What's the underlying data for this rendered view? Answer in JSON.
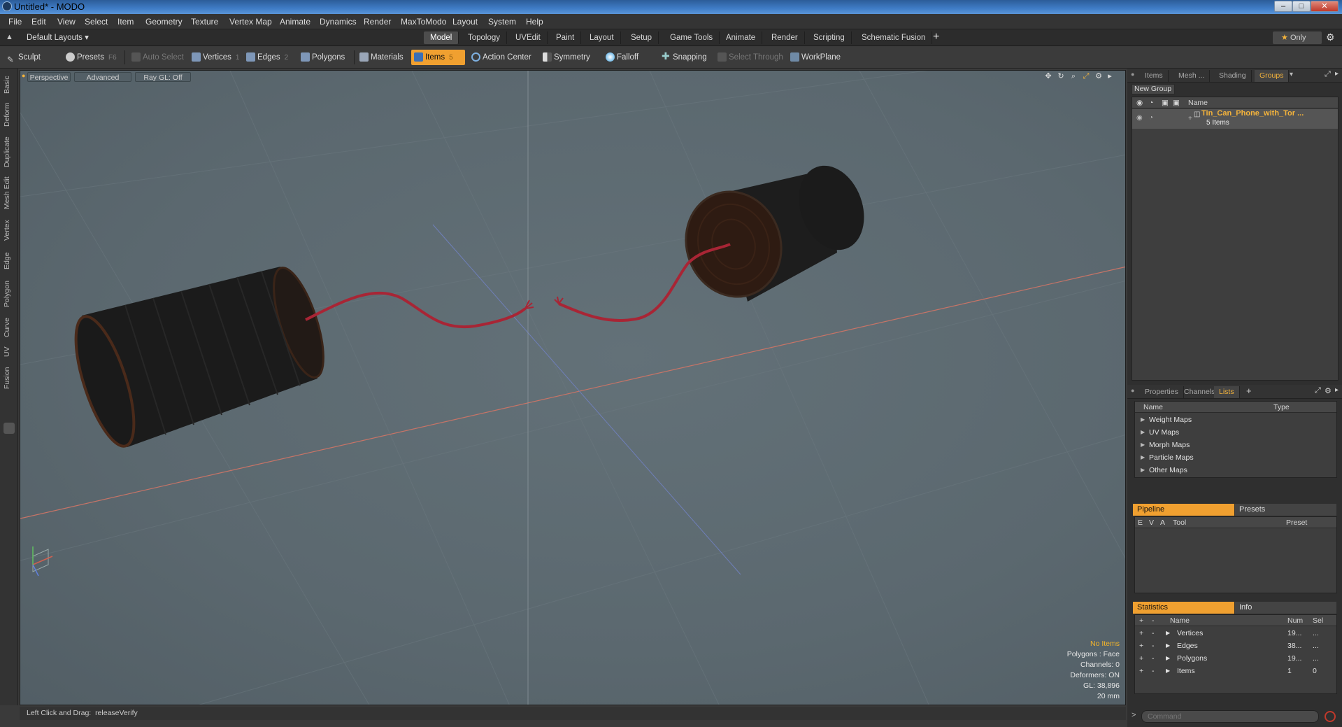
{
  "window": {
    "title": "Untitled* - MODO"
  },
  "menu": [
    "File",
    "Edit",
    "View",
    "Select",
    "Item",
    "Geometry",
    "Texture",
    "Vertex Map",
    "Animate",
    "Dynamics",
    "Render",
    "MaxToModo",
    "Layout",
    "System",
    "Help"
  ],
  "layout_selector": "Default Layouts",
  "layout_tabs": [
    "Model",
    "Topology",
    "UVEdit",
    "Paint",
    "Layout",
    "Setup",
    "Game Tools",
    "Animate",
    "Render",
    "Scripting",
    "Schematic Fusion"
  ],
  "active_layout_tab": "Model",
  "only_label": "Only",
  "toolbar": {
    "sculpt": "Sculpt",
    "presets": "Presets",
    "presets_hotkey": "F6",
    "auto_select": "Auto Select",
    "vertices": "Vertices",
    "vertices_hotkey": "1",
    "edges": "Edges",
    "edges_hotkey": "2",
    "polygons": "Polygons",
    "materials": "Materials",
    "items": "Items",
    "items_hotkey": "5",
    "action_center": "Action Center",
    "symmetry": "Symmetry",
    "falloff": "Falloff",
    "snapping": "Snapping",
    "select_through": "Select Through",
    "workplane": "WorkPlane"
  },
  "left_tabs": [
    "Basic",
    "Deform",
    "Duplicate",
    "Mesh Edit",
    "Vertex",
    "Edge",
    "Polygon",
    "Curve",
    "UV",
    "Fusion"
  ],
  "viewport": {
    "view_mode": "Perspective",
    "shading": "Advanced",
    "raygl": "Ray GL: Off",
    "info": {
      "selection": "No Items",
      "polygons": "Polygons : Face",
      "channels": "Channels: 0",
      "deformers": "Deformers: ON",
      "gl": "GL: 38,896",
      "scale": "20 mm"
    }
  },
  "status": {
    "hint_label": "Left Click and Drag:",
    "hint_value": "releaseVerify"
  },
  "groups_panel": {
    "tabs": [
      "Items",
      "Mesh ...",
      "Shading",
      "Groups"
    ],
    "active_tab": "Groups",
    "new_group": "New Group",
    "col_name": "Name",
    "group_name": "Tin_Can_Phone_with_Tor ...",
    "group_count": "5 Items"
  },
  "lists_panel": {
    "tabs": [
      "Properties",
      "Channels",
      "Lists"
    ],
    "active_tab": "Lists",
    "col_name": "Name",
    "col_type": "Type",
    "items": [
      "Weight Maps",
      "UV Maps",
      "Morph Maps",
      "Particle Maps",
      "Other Maps"
    ]
  },
  "pipeline_panel": {
    "tabs": [
      "Pipeline",
      "Presets"
    ],
    "cols": [
      "E",
      "V",
      "A",
      "Tool",
      "Preset"
    ]
  },
  "stats_panel": {
    "tabs": [
      "Statistics",
      "Info"
    ],
    "cols": {
      "plus": "+",
      "minus": "-",
      "name": "Name",
      "num": "Num",
      "sel": "Sel"
    },
    "rows": [
      {
        "name": "Vertices",
        "num": "19...",
        "sel": "..."
      },
      {
        "name": "Edges",
        "num": "38...",
        "sel": "..."
      },
      {
        "name": "Polygons",
        "num": "19...",
        "sel": "..."
      },
      {
        "name": "Items",
        "num": "1",
        "sel": "0"
      }
    ]
  },
  "command": {
    "placeholder": "Command"
  }
}
